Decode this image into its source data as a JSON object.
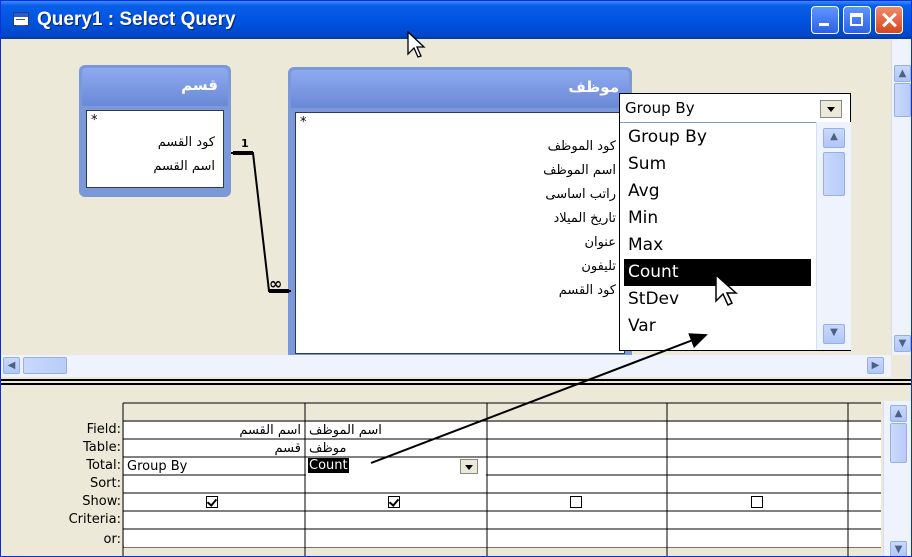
{
  "window": {
    "title": "Query1 : Select Query"
  },
  "tables": [
    {
      "name": "قسم",
      "star": "*",
      "fields": [
        "كود القسم",
        "اسم القسم"
      ]
    },
    {
      "name": "موظف",
      "star": "*",
      "fields": [
        "كود الموظف",
        "اسم الموظف",
        "راتب اساسى",
        "تاريخ الميلاد",
        "عنوان",
        "تليفون",
        "كود القسم"
      ]
    }
  ],
  "relationship": {
    "one_label": "1",
    "many_label": "∞"
  },
  "dropdown": {
    "current_value": "Group By",
    "options": [
      "Group By",
      "Sum",
      "Avg",
      "Min",
      "Max",
      "Count",
      "StDev",
      "Var"
    ],
    "selected": "Count"
  },
  "grid": {
    "row_labels": {
      "field": "Field:",
      "table": "Table:",
      "total": "Total:",
      "sort": "Sort:",
      "show": "Show:",
      "criteria": "Criteria:",
      "or": "or:"
    },
    "columns": [
      {
        "field": "اسم القسم",
        "table": "قسم",
        "total": "Group By",
        "show": true
      },
      {
        "field": "اسم الموظف",
        "table": "موظف",
        "total": "Count",
        "show": true
      },
      {
        "field": "",
        "table": "",
        "total": "",
        "show": false
      },
      {
        "field": "",
        "table": "",
        "total": "",
        "show": false
      }
    ]
  }
}
